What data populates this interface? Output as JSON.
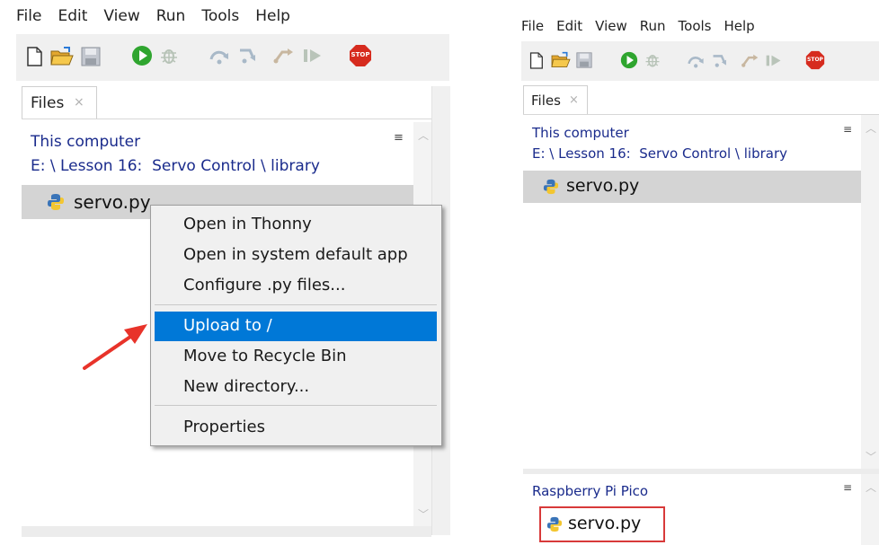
{
  "left": {
    "menu": [
      "File",
      "Edit",
      "View",
      "Run",
      "Tools",
      "Help"
    ],
    "toolbar_icons": [
      "new-file-icon",
      "open-folder-icon",
      "save-icon",
      "run-icon",
      "debug-icon",
      "step-over-icon",
      "step-into-icon",
      "step-out-icon",
      "resume-icon",
      "stop-icon"
    ],
    "stop_label": "STOP",
    "files_tab": {
      "label": "Files",
      "close": "×"
    },
    "this_computer": "This computer",
    "path": "E: \\ Lesson 16:  Servo Control \\ library",
    "panel_menu": "≡",
    "file_name": "servo.py",
    "context_menu": {
      "items": [
        "Open in Thonny",
        "Open in system default app",
        "Configure .py files...",
        "Upload to /",
        "Move to Recycle Bin",
        "New directory...",
        "Properties"
      ],
      "highlighted_index": 3
    },
    "arrow_color": "#e8332a"
  },
  "right": {
    "menu": [
      "File",
      "Edit",
      "View",
      "Run",
      "Tools",
      "Help"
    ],
    "stop_label": "STOP",
    "files_tab": {
      "label": "Files",
      "close": "×"
    },
    "this_computer": "This computer",
    "path": "E: \\ Lesson 16:  Servo Control \\ library",
    "panel_menu": "≡",
    "file_name": "servo.py",
    "device_label": "Raspberry Pi Pico",
    "device_file_name": "servo.py",
    "highlight_box_color": "#d83a3a"
  },
  "colors": {
    "selection": "#0078d7",
    "file_row": "#d4d4d4",
    "link": "#1a2b8c"
  }
}
